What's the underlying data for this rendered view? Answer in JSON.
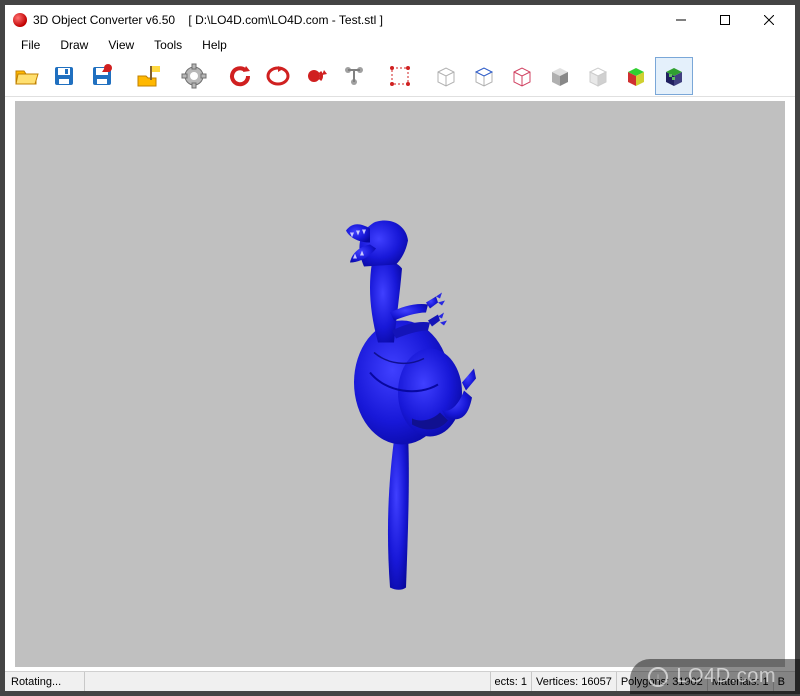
{
  "title": {
    "app_name": "3D Object Converter v6.50",
    "spacer": "    ",
    "file_path": "[ D:\\LO4D.com\\LO4D.com - Test.stl ]"
  },
  "menu": {
    "file": "File",
    "draw": "Draw",
    "view": "View",
    "tools": "Tools",
    "help": "Help"
  },
  "toolbar_icons": {
    "open": "open-folder-icon",
    "save": "save-icon",
    "save_as": "save-as-icon",
    "folder_flag": "folder-flag-icon",
    "settings": "gear-icon",
    "rotate_ccw": "rotate-ccw-icon",
    "rotate_cw": "rotate-cw-icon",
    "rotate_free": "rotate-free-icon",
    "axis": "axis-icon",
    "bounds": "bounds-icon",
    "wire1": "wireframe-gray-icon",
    "wire2": "wireframe-blue-icon",
    "wire3": "wireframe-red-icon",
    "shade1": "shaded-gray-icon",
    "shade2": "shaded-white-icon",
    "colorcube": "color-cube-icon",
    "checker": "checker-cube-icon"
  },
  "status": {
    "left": "Rotating...",
    "objects_label": "ects:",
    "objects_value": "1",
    "vertices_label": "Vertices:",
    "vertices_value": "16057",
    "polygons_label": "Polygons:",
    "polygons_value": "31902",
    "materials_label": "Materials:",
    "materials_value": "1",
    "tail": "B"
  },
  "watermark": {
    "text": "LO4D.com",
    "symbol": "↓"
  },
  "model": {
    "color": "#1818d8",
    "name": "dinosaur-model"
  }
}
